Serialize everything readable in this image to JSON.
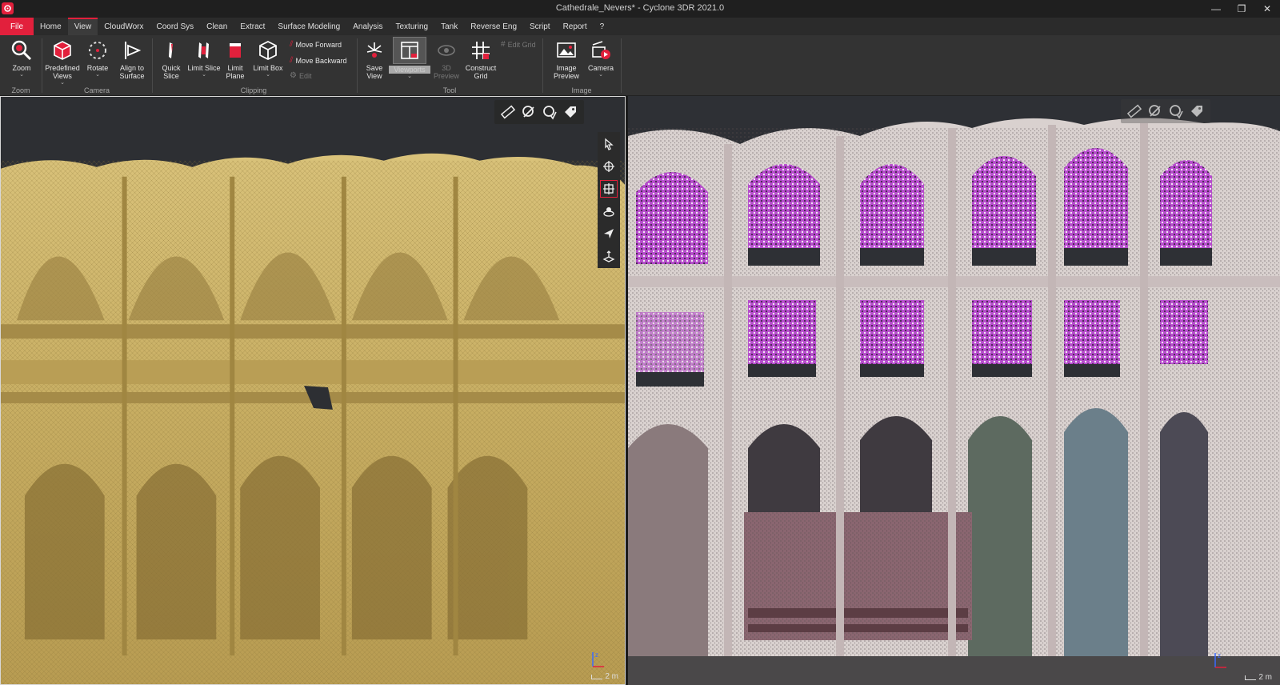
{
  "window": {
    "title": "Cathedrale_Nevers* - Cyclone 3DR 2021.0",
    "controls": [
      "minimize",
      "restore",
      "close"
    ]
  },
  "menu": {
    "tabs": [
      {
        "label": "File"
      },
      {
        "label": "Home"
      },
      {
        "label": "View"
      },
      {
        "label": "CloudWorx"
      },
      {
        "label": "Coord Sys"
      },
      {
        "label": "Clean"
      },
      {
        "label": "Extract"
      },
      {
        "label": "Surface Modeling"
      },
      {
        "label": "Analysis"
      },
      {
        "label": "Texturing"
      },
      {
        "label": "Tank"
      },
      {
        "label": "Reverse Eng"
      },
      {
        "label": "Script"
      },
      {
        "label": "Report"
      },
      {
        "label": "?"
      }
    ],
    "active": "View"
  },
  "ribbon": {
    "zoom": {
      "label1": "Zoom",
      "group": "Zoom"
    },
    "camera": {
      "predefined_line1": "Predefined",
      "predefined_line2": "Views",
      "rotate": "Rotate",
      "align_line1": "Align to",
      "align_line2": "Surface",
      "group": "Camera"
    },
    "clipping": {
      "quick_line1": "Quick",
      "quick_line2": "Slice",
      "limit_slice": "Limit Slice",
      "limit_plane_line1": "Limit",
      "limit_plane_line2": "Plane",
      "limit_box": "Limit Box",
      "move_forward": "Move Forward",
      "move_backward": "Move Backward",
      "edit": "Edit",
      "group": "Clipping"
    },
    "tool": {
      "save_line1": "Save",
      "save_line2": "View",
      "viewports": "Viewports",
      "preview_3d": "3D Preview",
      "construct_line1": "Construct",
      "construct_line2": "Grid",
      "edit_grid": "Edit Grid",
      "group": "Tool"
    },
    "image": {
      "image_line1": "Image",
      "image_line2": "Preview",
      "camera": "Camera",
      "group": "Image"
    }
  },
  "viewports": {
    "left": {
      "scale": "2 m",
      "axis_label": "z"
    },
    "right": {
      "scale": "2 m",
      "axis_label": "z"
    }
  },
  "colors": {
    "accent": "#e2203c",
    "mesh": "#c9b167",
    "pointcloud_stone": "#d9d1cf",
    "stained_glass": "#c553d8"
  },
  "icons": {
    "viewport_toolbar": [
      "ruler-icon",
      "label-icon",
      "annotation-icon",
      "tag-icon"
    ],
    "navigation": [
      "select-icon",
      "pan-icon",
      "fit-icon",
      "orbit-icon",
      "fly-icon",
      "elevation-icon"
    ]
  }
}
